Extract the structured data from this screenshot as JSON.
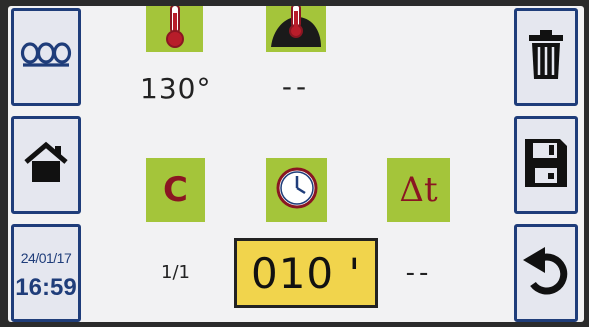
{
  "left_sidebar": {
    "date": "24/01/17",
    "time": "16:59"
  },
  "params": {
    "temperature": {
      "value": "130°",
      "icon": "thermometer-icon"
    },
    "probe": {
      "value": "--",
      "icon": "probe-icon"
    },
    "cycle": {
      "label": "C",
      "value": "1/1"
    },
    "timer": {
      "value": "010 '",
      "icon": "clock-icon"
    },
    "delta": {
      "label": "Δt",
      "value": "--"
    }
  },
  "colors": {
    "tile": "#a4c53a",
    "highlight": "#f1d44c",
    "frame": "#1f3d7a",
    "icon_red": "#b81d2a"
  }
}
